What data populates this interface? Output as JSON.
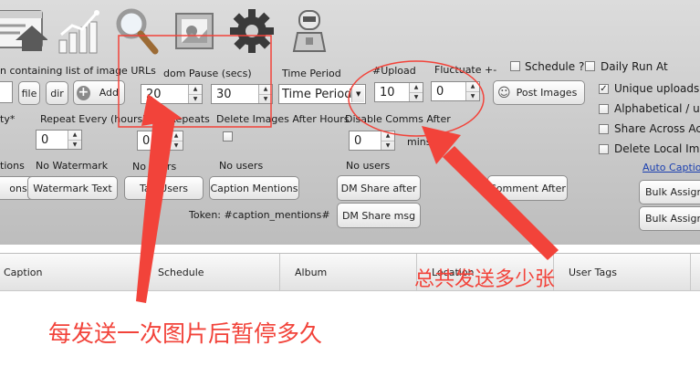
{
  "toolbar": {
    "icons": [
      "list-upload-icon",
      "bar-chart-icon",
      "magnifier-icon",
      "image-frame-icon",
      "gear-icon",
      "robot-icon"
    ]
  },
  "labels": {
    "file_list": "n containing list of image URLs",
    "random_pause": "dom Pause (secs)",
    "time_period": "Time Period",
    "num_upload": "#Upload",
    "fluctuate": "Fluctuate +-",
    "schedule": "Schedule ?",
    "daily_run_at": "Daily Run At",
    "property": "ty*",
    "repeat_every": "Repeat Every (hours)",
    "num_repeats": "Num Repeats",
    "delete_images_after_hours": "Delete Images After Hours",
    "disable_comms_after": "Disable Comms After",
    "mins": "mins",
    "mentions": "tions",
    "no_watermark": "No Watermark",
    "no_users_1": "No users",
    "no_users_2": "No users",
    "no_users_3": "No users",
    "token": "Token: #caption_mentions#",
    "auto_caption": "Auto Captio"
  },
  "buttons": {
    "file": "file",
    "dir": "dir",
    "add": "Add",
    "post_images": "Post Images",
    "mentions": "ons",
    "watermark_text": "Watermark Text",
    "tag_users": "Tag Users",
    "caption_mentions": "Caption Mentions",
    "dm_share_after": "DM Share after",
    "dm_share_msg": "DM Share msg",
    "comment_after": "Comment After",
    "bulk_assign_1": "Bulk Assign",
    "bulk_assign_2": "Bulk Assign"
  },
  "inputs": {
    "pause_min": "20",
    "pause_max": "30",
    "time_period": "Time Period",
    "num_upload": "10",
    "fluctuate": "0",
    "repeat_every": "0",
    "num_repeats": "0",
    "disable_comms_after": "0"
  },
  "options": {
    "unique_uploads": "Unique uploads o",
    "alphabetical": "Alphabetical / unc",
    "share_across": "Share Across Acco",
    "delete_local": "Delete Local Imag"
  },
  "checked": {
    "unique_uploads": "✓"
  },
  "grid": {
    "columns": [
      "Caption",
      "Schedule",
      "Album",
      "Location",
      "User Tags"
    ]
  },
  "annotations": {
    "pause_note": "每发送一次图片后暂停多久",
    "total_note": "总共发送多少张"
  },
  "colors": {
    "annotation": "#f2433a",
    "link": "#1a3fb0"
  }
}
